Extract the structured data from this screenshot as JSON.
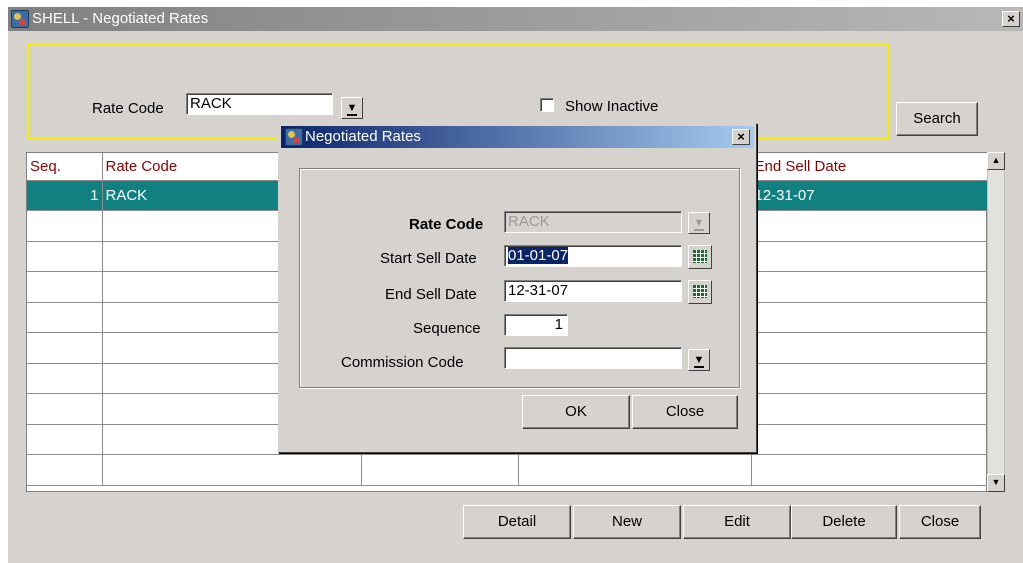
{
  "window": {
    "title": "SHELL - Negotiated Rates",
    "close_glyph": "×"
  },
  "search": {
    "rate_code_label": "Rate Code",
    "rate_code_value": "RACK",
    "show_inactive_label": "Show Inactive",
    "search_button": "Search"
  },
  "grid": {
    "columns": [
      "Seq.",
      "Rate Code",
      "",
      "",
      "End Sell Date"
    ],
    "rows": [
      [
        "1",
        "RACK",
        "",
        "",
        "12-31-07"
      ],
      [
        "",
        "",
        "",
        "",
        ""
      ],
      [
        "",
        "",
        "",
        "",
        ""
      ],
      [
        "",
        "",
        "",
        "",
        ""
      ],
      [
        "",
        "",
        "",
        "",
        ""
      ],
      [
        "",
        "",
        "",
        "",
        ""
      ],
      [
        "",
        "",
        "",
        "",
        ""
      ],
      [
        "",
        "",
        "",
        "",
        ""
      ],
      [
        "",
        "",
        "",
        "",
        ""
      ],
      [
        "",
        "",
        "",
        "",
        ""
      ]
    ],
    "selected_row": 0
  },
  "dialog": {
    "title": "Negotiated Rates",
    "close_glyph": "×",
    "rate_code_label": "Rate Code",
    "rate_code_value": "RACK",
    "start_sell_label": "Start Sell Date",
    "start_sell_value": "01-01-07",
    "end_sell_label": "End Sell Date",
    "end_sell_value": "12-31-07",
    "sequence_label": "Sequence",
    "sequence_value": "1",
    "commission_label": "Commission Code",
    "commission_value": "",
    "ok_button": "OK",
    "close_button": "Close"
  },
  "bottom_buttons": {
    "detail": "Detail",
    "new": "New",
    "edit": "Edit",
    "delete": "Delete",
    "close": "Close"
  },
  "colors": {
    "selected_row": "#118080",
    "header_text": "#8b0000",
    "search_frame": "#f4f000",
    "dialog_title": "#0a246a"
  }
}
